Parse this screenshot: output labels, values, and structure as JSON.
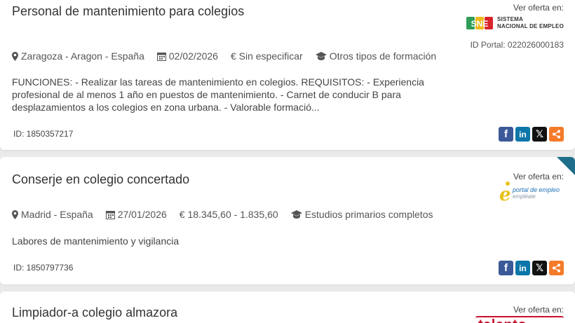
{
  "offers": [
    {
      "title": "Personal de mantenimiento para colegios",
      "location": "Zaragoza - Aragon - España",
      "date": "02/02/2026",
      "salary": "€ Sin especificar",
      "education": "Otros tipos de formación",
      "description": "FUNCIONES:  - Realizar las tareas de mantenimiento en colegios.    REQUISITOS:  - Experiencia profesional de al menos 1 año en puestos de mantenimiento.  - Carnet de conducir B para desplazamientos a los colegios en zona urbana.  - Valorable formació...",
      "id": "ID: 1850357217",
      "ver_oferta": "Ver oferta en:",
      "source_logo": {
        "line1": "SISTEMA",
        "line2": "NACIONAL DE EMPLEO",
        "mark": "SNE"
      },
      "id_portal": "ID Portal: 022026000183"
    },
    {
      "title": "Conserje en colegio concertado",
      "location": "Madrid - España",
      "date": "27/01/2026",
      "salary": "€ 18.345,60 - 1.835,60",
      "education": "Estudios primarios completos",
      "description": "Labores de mantenimiento y vigilancia",
      "id": "ID: 1850797736",
      "ver_oferta": "Ver oferta en:",
      "source_logo": {
        "line1": "portal de empleo",
        "line2": "empléate",
        "mark": "e"
      }
    },
    {
      "title": "Limpiador-a colegio almazora",
      "ver_oferta": "Ver oferta en:",
      "source_logo": {
        "mark": "talento"
      }
    }
  ],
  "share_icons": [
    "facebook-icon",
    "linkedin-icon",
    "x-icon",
    "share-icon"
  ],
  "colors": {
    "facebook": "#3b5998",
    "linkedin": "#0e76a8",
    "x": "#111111",
    "share": "#f47b2a",
    "corner": "#1f6f8b"
  }
}
